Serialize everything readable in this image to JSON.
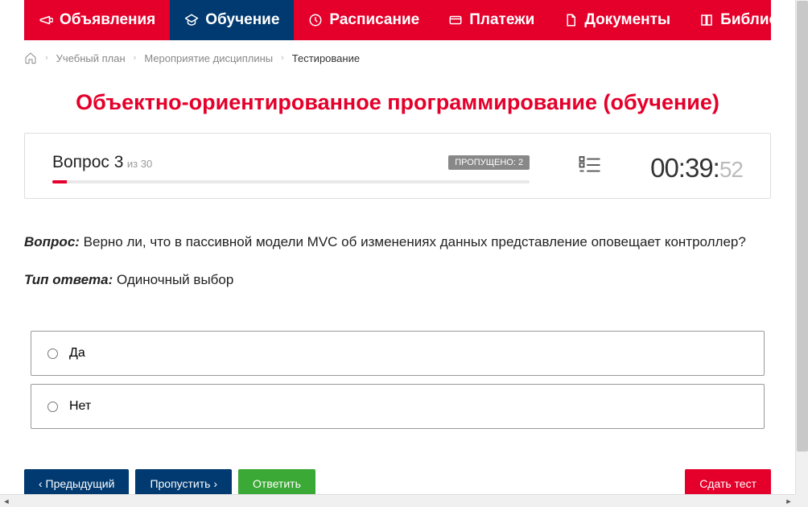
{
  "nav": {
    "items": [
      {
        "label": "Объявления",
        "icon": "megaphone"
      },
      {
        "label": "Обучение",
        "icon": "education",
        "active": true
      },
      {
        "label": "Расписание",
        "icon": "clock"
      },
      {
        "label": "Платежи",
        "icon": "card"
      },
      {
        "label": "Документы",
        "icon": "doc"
      },
      {
        "label": "Библиотека",
        "icon": "book",
        "dropdown": true
      }
    ]
  },
  "breadcrumb": {
    "items": [
      "Учебный план",
      "Мероприятие дисциплины"
    ],
    "current": "Тестирование"
  },
  "page_title": "Объектно-ориентированное программирование (обучение)",
  "status": {
    "question_label": "Вопрос 3",
    "total_label": "из 30",
    "skipped_label": "ПРОПУЩЕНО: 2",
    "timer_main": "00:39:",
    "timer_sec": "52",
    "progress_percent": 3
  },
  "question": {
    "q_prefix": "Вопрос:",
    "q_text": " Верно ли, что в пассивной модели MVC об изменениях данных представление оповещает контроллер?",
    "type_prefix": "Тип ответа:",
    "type_text": " Одиночный выбор"
  },
  "answers": [
    {
      "label": "Да"
    },
    {
      "label": "Нет"
    }
  ],
  "buttons": {
    "prev": "‹ Предыдущий",
    "skip": "Пропустить ›",
    "answer": "Ответить",
    "submit": "Сдать тест"
  }
}
